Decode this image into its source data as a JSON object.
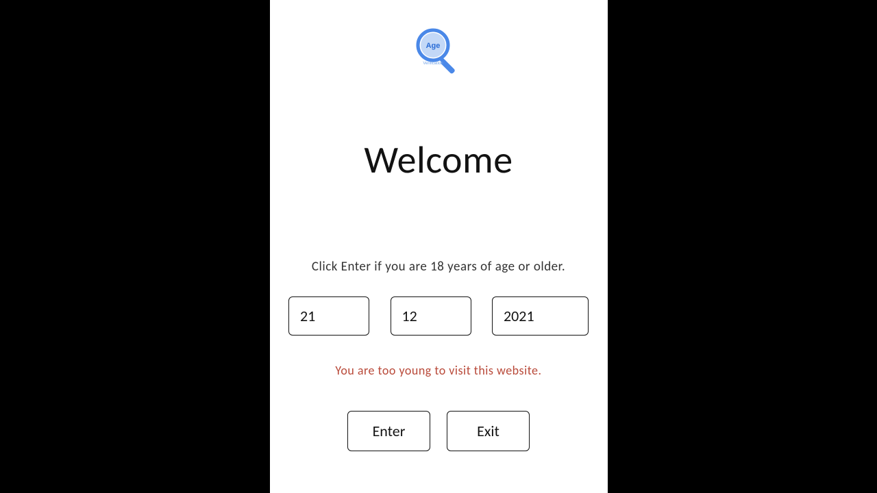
{
  "logo": {
    "text_top": "Age",
    "text_bottom": "Verification"
  },
  "heading": "Welcome",
  "instruction": "Click Enter if you are 18 years of age or older.",
  "date": {
    "day": "21",
    "month": "12",
    "year": "2021"
  },
  "error_message": "You are too young to visit this website.",
  "buttons": {
    "enter": "Enter",
    "exit": "Exit"
  }
}
